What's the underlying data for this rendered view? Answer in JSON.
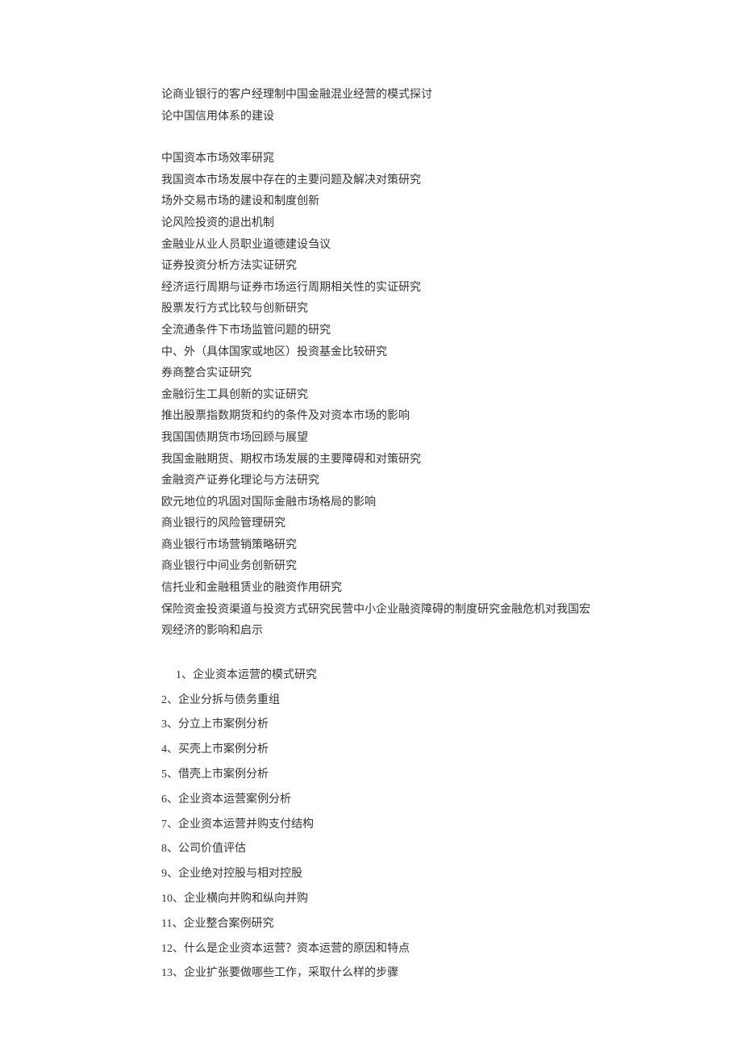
{
  "section1": [
    "论商业银行的客户经理制中国金融混业经营的模式探讨",
    "论中国信用体系的建设"
  ],
  "section2": [
    "中国资本市场效率研窕",
    "我国资本市场发展中存在的主要问题及解决对策研究",
    "场外交易市场的建设和制度创新",
    "论风险投资的退出机制",
    "金融业从业人员职业道德建设刍议",
    "证券投资分析方法实证研究",
    "经济运行周期与证券市场运行周期相关性的实证研究",
    "股票发行方式比较与创新研究",
    "全流通条件下市场监管问题的研究",
    "中、外（具体国家或地区）投资基金比较研究",
    "券商整合实证研究",
    "金融衍生工具创新的实证研究",
    "推出股票指数期货和约的条件及对资本市场的影响",
    "我国国债期货市场回顾与展望",
    "我国金融期货、期权市场发展的主要障碍和对策研究",
    "金融资产证券化理论与方法研究",
    "欧元地位的巩固对国际金融市场格局的影响",
    "商业银行的风险管理研究",
    "商业银行市场营销策略研究",
    "商业银行中间业务创新研究",
    "信托业和金融租赁业的融资作用研究",
    "保险资金投资渠道与投资方式研究民营中小企业融资障碍的制度研究金融危机对我国宏观经济的影响和启示"
  ],
  "numbered": [
    "1、企业资本运营的模式研究",
    "2、企业分拆与债务重组",
    "3、分立上市案例分析",
    "4、买壳上市案例分析",
    "5、借壳上市案例分析",
    "6、企业资本运营案例分析",
    "7、企业资本运营并购支付结构",
    "8、公司价值评估",
    "9、企业绝对控股与相对控股",
    "10、企业横向并购和纵向并购",
    "11、企业整合案例研究",
    "12、什么是企业资本运营？资本运营的原因和特点",
    "13、企业扩张要做哪些工作，采取什么样的步骤"
  ]
}
